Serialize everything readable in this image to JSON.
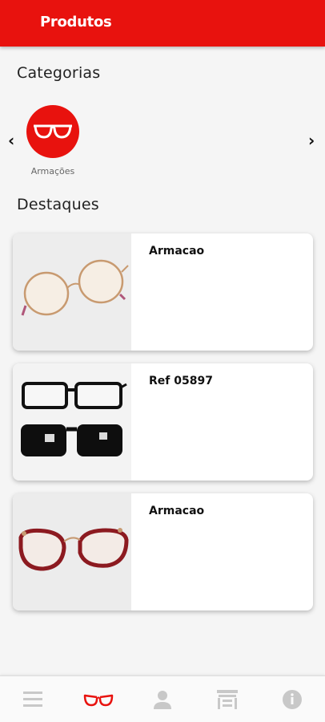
{
  "header": {
    "title": "Produtos"
  },
  "categories": {
    "heading": "Categorias",
    "prev_arrow": "‹",
    "next_arrow": "›",
    "items": [
      {
        "label": "Armações",
        "icon": "glasses-icon"
      }
    ]
  },
  "featured": {
    "heading": "Destaques",
    "products": [
      {
        "name": "Armacao",
        "image": "gold-round-glasses"
      },
      {
        "name": "Ref 05897",
        "image": "black-clip-on-sunglasses"
      },
      {
        "name": "Armacao",
        "image": "red-cat-eye-glasses"
      }
    ]
  },
  "bottom_nav": {
    "items": [
      {
        "icon": "menu-icon",
        "active": false
      },
      {
        "icon": "glasses-icon",
        "active": true
      },
      {
        "icon": "user-icon",
        "active": false
      },
      {
        "icon": "store-icon",
        "active": false
      },
      {
        "icon": "info-icon",
        "active": false
      }
    ]
  },
  "colors": {
    "accent": "#e8120e",
    "inactive_icon": "#c8c8c8"
  }
}
